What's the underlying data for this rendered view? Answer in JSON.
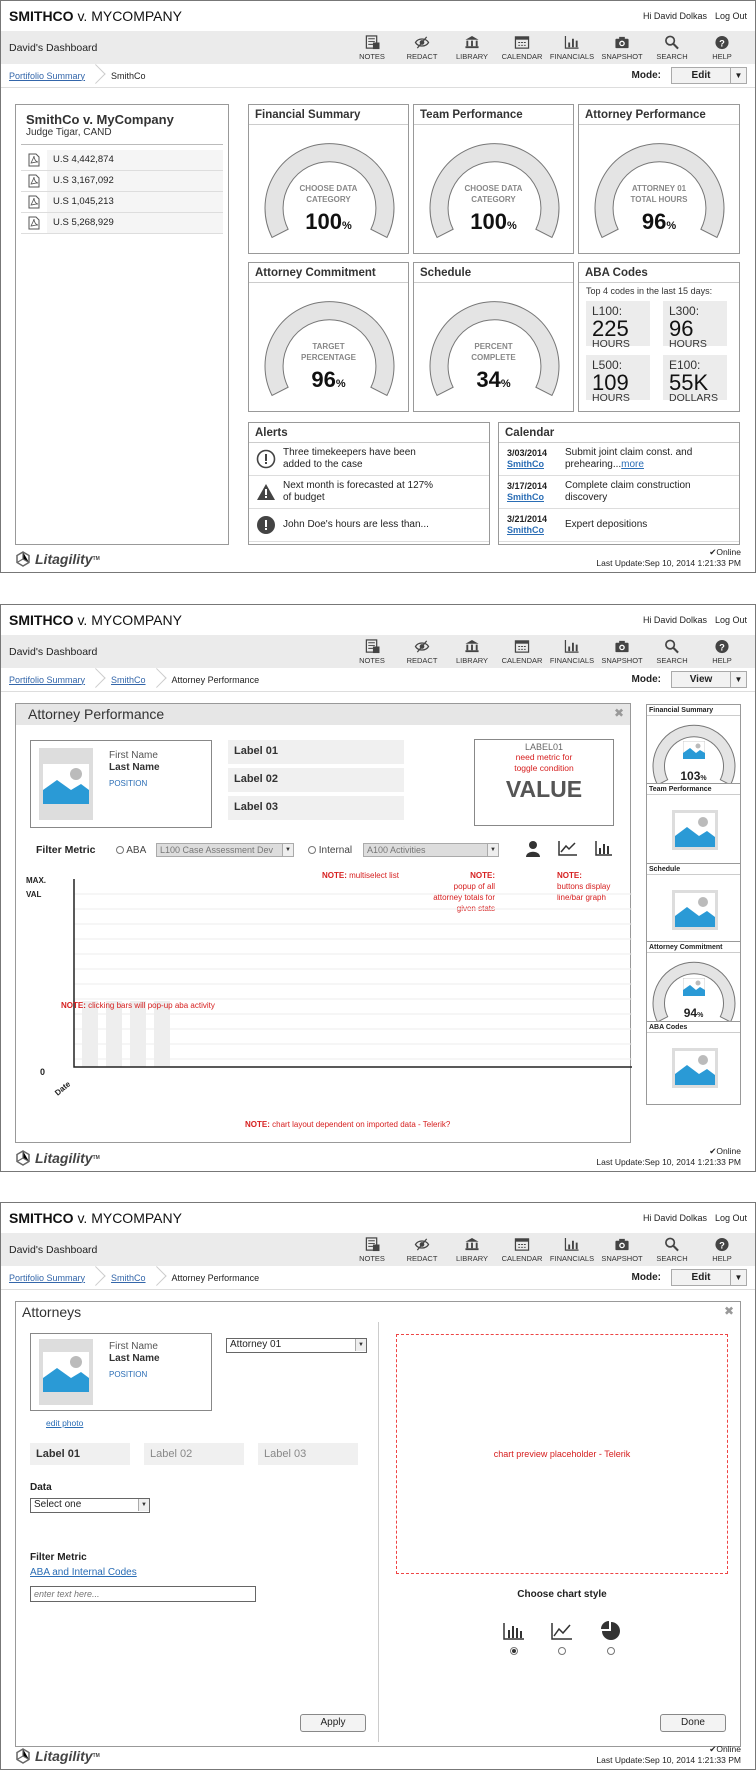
{
  "header": {
    "case_title_bold": "SMITHCO",
    "case_title_rest": " v. MYCOMPANY",
    "greeting": "Hi David Dolkas",
    "logout": "Log Out",
    "dashboard_title": "David's Dashboard",
    "nav": [
      "NOTES",
      "REDACT",
      "LIBRARY",
      "CALENDAR",
      "FINANCIALS",
      "SNAPSHOT",
      "SEARCH",
      "HELP"
    ],
    "notes_badge": "4",
    "mode_label": "Mode:"
  },
  "footer": {
    "logo": "Litagility",
    "logo_tm": "TM",
    "online": "Online",
    "last_update": "Last Update:Sep 10, 2014 1:21:33 PM"
  },
  "screen1": {
    "crumbs": [
      "Portifolio Summary",
      "SmithCo"
    ],
    "mode_value": "Edit",
    "case_panel": {
      "title": "SmithCo v. MyCompany",
      "judge": "Judge Tigar, CAND",
      "amounts": [
        "U.S 4,442,874",
        "U.S 3,167,092",
        "U.S 1,045,213",
        "U.S 5,268,929"
      ]
    },
    "financial": {
      "title": "Financial Summary",
      "label1": "CHOOSE DATA",
      "label2": "CATEGORY",
      "value": "100",
      "unit": "%",
      "fill": 1.0
    },
    "team": {
      "title": "Team Performance",
      "label1": "CHOOSE DATA",
      "label2": "CATEGORY",
      "value": "100",
      "unit": "%",
      "fill": 1.0
    },
    "attorney": {
      "title": "Attorney Performance",
      "label1": "ATTORNEY 01",
      "label2": "TOTAL HOURS",
      "value": "96",
      "unit": "%",
      "fill": 0.96
    },
    "commitment": {
      "title": "Attorney Commitment",
      "label1": "TARGET",
      "label2": "PERCENTAGE",
      "value": "96",
      "unit": "%",
      "fill": 0.96
    },
    "schedule": {
      "title": "Schedule",
      "label1": "PERCENT",
      "label2": "COMPLETE",
      "value": "34",
      "unit": "%",
      "fill": 0.34
    },
    "aba": {
      "title": "ABA Codes",
      "subtitle": "Top 4 codes in the last 15 days:",
      "cells": [
        {
          "code": "L100:",
          "num": "225",
          "unit": "HOURS"
        },
        {
          "code": "L300:",
          "num": "96",
          "unit": "HOURS"
        },
        {
          "code": "L500:",
          "num": "109",
          "unit": "HOURS"
        },
        {
          "code": "E100:",
          "num": "55K",
          "unit": "DOLLARS"
        }
      ]
    },
    "alerts": {
      "title": "Alerts",
      "items": [
        {
          "l1": "Three timekeepers have been",
          "l2": "added to the case"
        },
        {
          "l1": "Next month is forecasted at 127%",
          "l2": "of budget"
        },
        {
          "l1": "John Doe's hours are less than...",
          "l2": ""
        }
      ]
    },
    "calendar": {
      "title": "Calendar",
      "more": "more",
      "items": [
        {
          "date": "3/03/2014",
          "who": "SmithCo",
          "l1": "Submit joint claim const. and",
          "l2": "prehearing..."
        },
        {
          "date": "3/17/2014",
          "who": "SmithCo",
          "l1": "Complete claim construction",
          "l2": "discovery"
        },
        {
          "date": "3/21/2014",
          "who": "SmithCo",
          "l1": "Expert depositions",
          "l2": ""
        }
      ]
    }
  },
  "screen2": {
    "crumbs": [
      "Portifolio Summary",
      "SmithCo",
      "Attorney Performance"
    ],
    "mode_value": "View",
    "panel_title": "Attorney Performance",
    "close": "✖",
    "first_name": "First Name",
    "last_name": "Last Name",
    "position": "POSITION",
    "labels": [
      "Label 01",
      "Label 02",
      "Label 03"
    ],
    "value_box": {
      "label": "LABEL01",
      "note1": "need metric for",
      "note2": "toggle condition",
      "value": "VALUE"
    },
    "filter_label": "Filter Metric",
    "aba_radio": "ABA",
    "aba_select": "L100 Case Assessment Dev",
    "internal_radio": "Internal",
    "internal_select": "A100 Activities",
    "notes": {
      "n_label": "NOTE:",
      "multiselect": "multiselect list",
      "popup1": "popup of all",
      "popup2": "attorney totals for",
      "popup3": "given stats",
      "buttons1": "buttons display",
      "buttons2": "line/bar graph",
      "clicking": "clicking bars will pop-up aba activity",
      "layout": "chart layout dependent on imported data - Telerik?"
    },
    "chart": {
      "y_max1": "MAX.",
      "y_max2": "VAL",
      "y_zero": "0",
      "x_label": "Date"
    },
    "minis": [
      {
        "title": "Financial Summary",
        "value": "103",
        "unit": "%"
      },
      {
        "title": "Team Performance"
      },
      {
        "title": "Schedule"
      },
      {
        "title": "Attorney Commitment",
        "value": "94",
        "unit": "%"
      },
      {
        "title": "ABA Codes"
      }
    ]
  },
  "screen3": {
    "crumbs": [
      "Portifolio Summary",
      "SmithCo",
      "Attorney Performance"
    ],
    "mode_value": "Edit",
    "panel_title": "Attorneys",
    "close": "✖",
    "first_name": "First Name",
    "last_name": "Last Name",
    "position": "POSITION",
    "edit_photo": "edit photo",
    "attorney_select": "Attorney 01",
    "labels": [
      "Label 01",
      "Label 02",
      "Label 03"
    ],
    "data_label": "Data",
    "data_select": "Select one",
    "filter_label": "Filter Metric",
    "filter_link": "ABA and Internal Codes",
    "filter_placeholder": "enter text here...",
    "apply": "Apply",
    "preview": "chart preview placeholder - Telerik",
    "chart_style": "Choose chart style",
    "done": "Done"
  }
}
